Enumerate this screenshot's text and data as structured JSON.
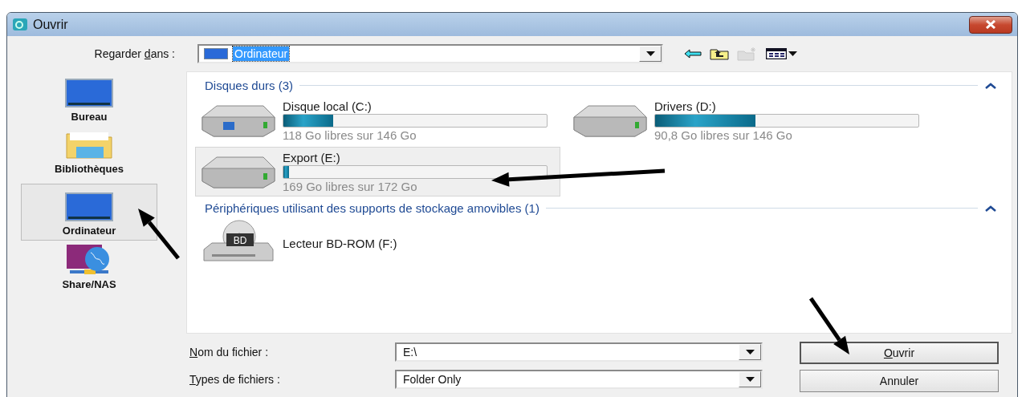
{
  "window": {
    "title": "Ouvrir"
  },
  "look_in": {
    "label": {
      "before": "Regarder ",
      "key": "d",
      "after": "ans :"
    },
    "value": "Ordinateur",
    "value_selected": true
  },
  "toolbar": [
    {
      "kind": "back",
      "disabled": false
    },
    {
      "kind": "up",
      "disabled": false
    },
    {
      "kind": "new_folder",
      "disabled": true
    },
    {
      "kind": "views",
      "disabled": false
    }
  ],
  "sidebar": {
    "items": [
      {
        "kind": "desktop",
        "label": "Bureau",
        "selected": false
      },
      {
        "kind": "libraries",
        "label": "Bibliothèques",
        "selected": false
      },
      {
        "kind": "computer",
        "label": "Ordinateur",
        "selected": true
      },
      {
        "kind": "network",
        "label": "Share/NAS",
        "selected": false
      }
    ]
  },
  "sections": [
    {
      "title": "Disques durs (3)",
      "expanded": true,
      "items": [
        {
          "kind": "hdd",
          "name": "Disque local (C:)",
          "level": 0.19,
          "free": "118 Go libres sur 146 Go",
          "selected": false,
          "system": true
        },
        {
          "kind": "hdd",
          "name": "Drivers (D:)",
          "level": 0.38,
          "free": "90,8 Go libres sur 146 Go",
          "selected": false,
          "system": false
        },
        {
          "kind": "hdd",
          "name": "Export (E:)",
          "level": 0.02,
          "free": "169 Go libres sur 172 Go",
          "selected": true,
          "system": false
        }
      ]
    },
    {
      "title": "Périphériques utilisant des supports de stockage amovibles (1)",
      "expanded": true,
      "items": [
        {
          "kind": "optical",
          "name": "Lecteur BD-ROM (F:)",
          "badge": "BD",
          "selected": false
        }
      ]
    }
  ],
  "file_name": {
    "label": {
      "key": "N",
      "after": "om du fichier :"
    },
    "value": "E:\\"
  },
  "file_type": {
    "label": {
      "key": "T",
      "after": "ypes de fichiers :"
    },
    "value": "Folder Only"
  },
  "buttons": [
    {
      "label": {
        "key": "O",
        "after": "uvrir"
      },
      "default": true
    },
    {
      "label": {
        "before": "Annuler"
      },
      "default": false
    }
  ]
}
